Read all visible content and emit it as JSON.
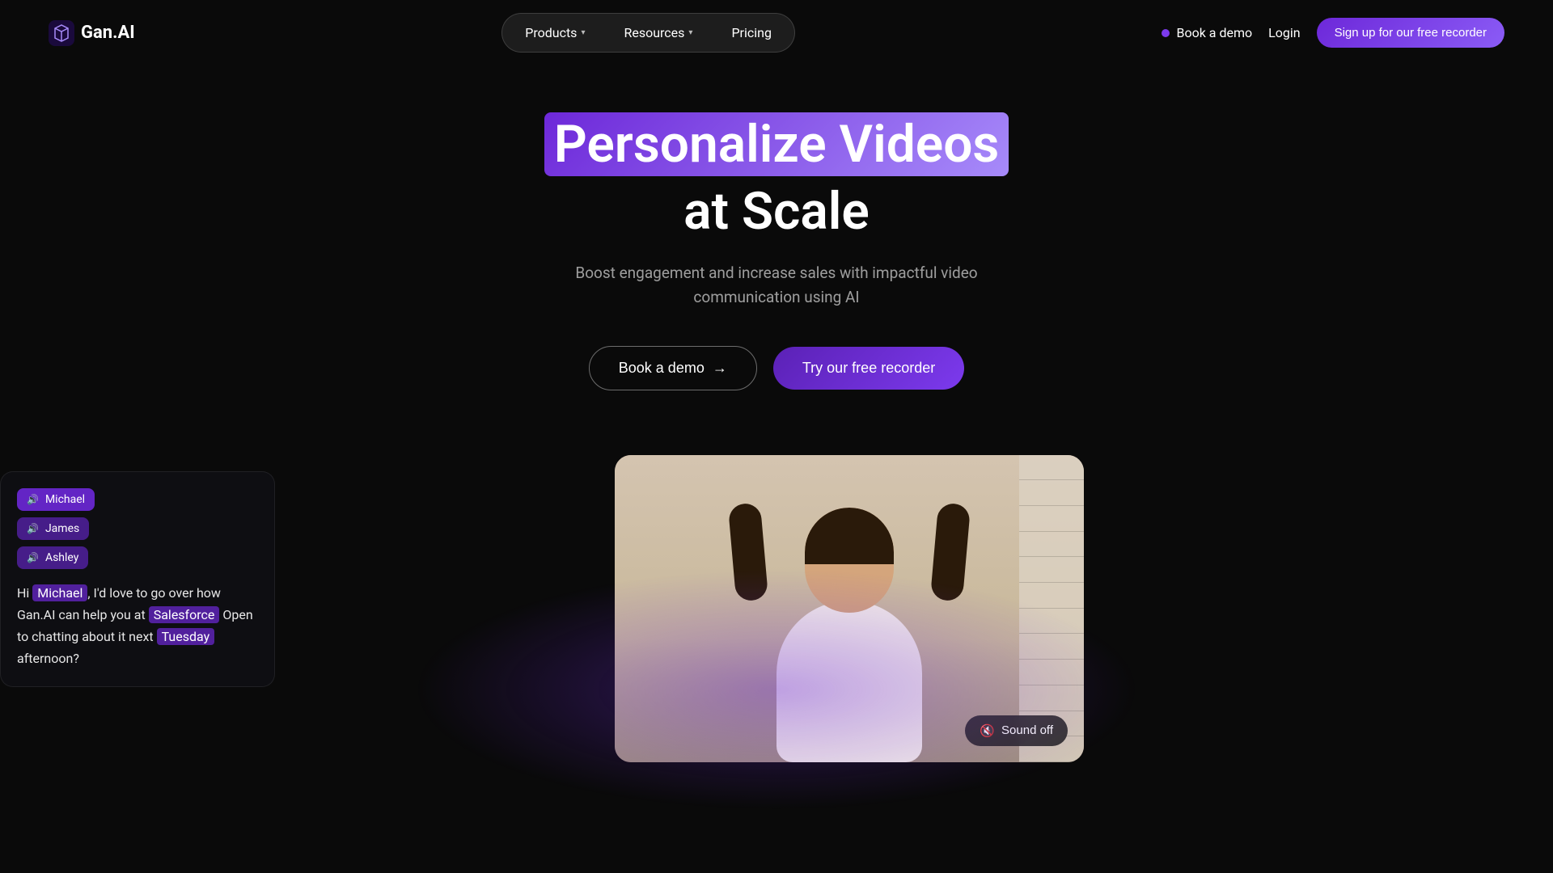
{
  "logo": {
    "text": "Gan.AI"
  },
  "nav": {
    "items": [
      {
        "label": "Products",
        "has_dropdown": true
      },
      {
        "label": "Resources",
        "has_dropdown": true
      },
      {
        "label": "Pricing",
        "has_dropdown": false
      }
    ],
    "book_demo_label": "Book a demo",
    "login_label": "Login",
    "signup_label": "Sign up for our free recorder"
  },
  "hero": {
    "title_line1_prefix": "Personalize Videos",
    "title_line2": "at Scale",
    "subtitle": "Boost engagement and increase sales with impactful video\ncommunication using AI",
    "btn_book_demo": "Book a demo",
    "btn_try_recorder": "Try our free recorder"
  },
  "persona_panel": {
    "personas": [
      {
        "name": "Michael",
        "active": true
      },
      {
        "name": "James",
        "active": false
      },
      {
        "name": "Ashley",
        "active": false
      }
    ],
    "speech": {
      "intro": "Hi ",
      "name": "Michael",
      "mid1": ", I'd love to go over how Gan.AI can help you at ",
      "company": "Salesforce",
      "mid2": " Open to chatting about it next ",
      "day": "Tuesday",
      "outro": " afternoon?"
    }
  },
  "video": {
    "sound_off_label": "Sound off"
  }
}
